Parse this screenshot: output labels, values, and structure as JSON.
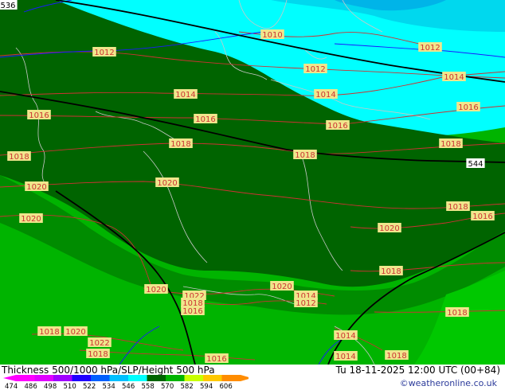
{
  "title": "Thickness 500/1000 hPa/SLP/Height 500 hPa",
  "datetime": "Tu 18-11-2025 12:00 UTC (00+84)",
  "credit": "©weatheronline.co.uk",
  "colors": {
    "cyan_bright": "#00ffff",
    "cyan_mid": "#00d8ee",
    "cyan_dark": "#00b4e8",
    "green_dark": "#006400",
    "green_mid": "#008c00",
    "green_light": "#00b400",
    "green_bright": "#00c800",
    "slp_isobar": "#cc3333",
    "thickness_line": "#1a1aff",
    "height_line": "#000000",
    "label_bg": "#f0e68c"
  },
  "height_labels": [
    "536",
    "544"
  ],
  "slp_labels": [
    "1010",
    "1012",
    "1012",
    "1012",
    "1014",
    "1014",
    "1014",
    "1016",
    "1016",
    "1016",
    "1016",
    "1018",
    "1018",
    "1018",
    "1018",
    "1018",
    "1020",
    "1020",
    "1020",
    "1020",
    "1020",
    "1020",
    "1022",
    "1018",
    "1016",
    "1014",
    "1018",
    "1020",
    "1022",
    "1018",
    "1016",
    "1014",
    "1014",
    "1012",
    "1018",
    "1018",
    "1018",
    "1016"
  ],
  "scale_labels": [
    "474",
    "486",
    "498",
    "510",
    "522",
    "534",
    "546",
    "558",
    "570",
    "582",
    "594",
    "606"
  ],
  "scale_colors": [
    "#ff00ff",
    "#e000ff",
    "#a000ff",
    "#2000ff",
    "#0060ff",
    "#00c0ff",
    "#00ffff",
    "#006400",
    "#00b400",
    "#c8ff00",
    "#ffc800",
    "#ff8c00"
  ]
}
